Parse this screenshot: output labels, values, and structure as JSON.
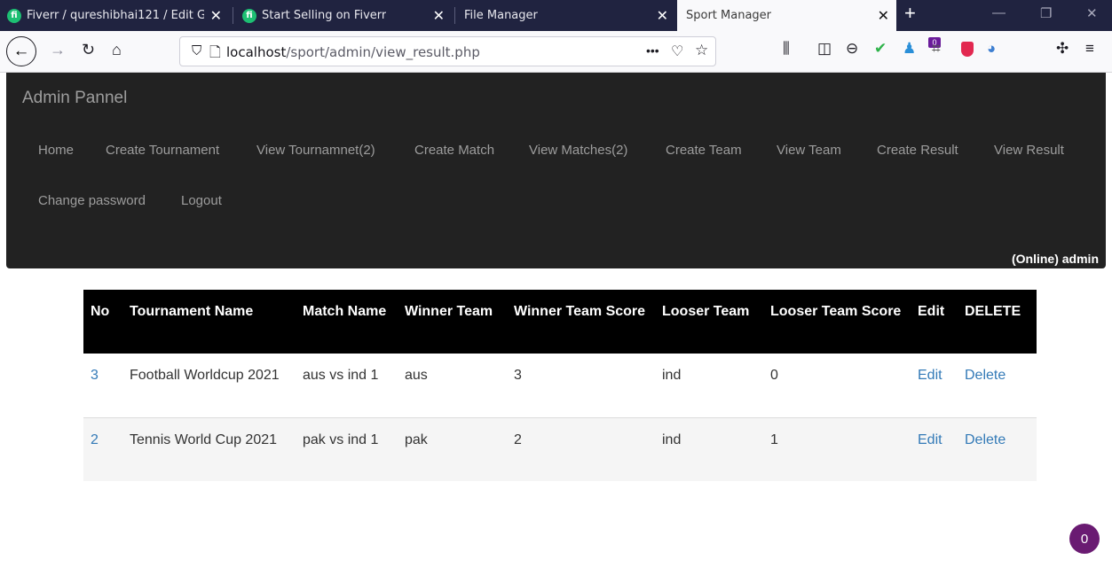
{
  "browser": {
    "tabs": [
      {
        "title": "Fiverr / qureshibhai121 / Edit G",
        "has_favicon": true,
        "active": false
      },
      {
        "title": "Start Selling on Fiverr",
        "has_favicon": true,
        "active": false
      },
      {
        "title": "File Manager",
        "has_favicon": false,
        "active": false
      },
      {
        "title": "Sport Manager",
        "has_favicon": false,
        "active": true
      }
    ],
    "url_host": "localhost",
    "url_path": "/sport/admin/view_result.php",
    "page_actions": "•••",
    "extension_badge": "0"
  },
  "admin": {
    "brand": "Admin Pannel",
    "menu_row1": [
      "Home",
      "Create Tournament",
      "View Tournamnet(2)",
      "Create Match",
      "View Matches(2)",
      "Create Team",
      "View Team",
      "Create Result",
      "View Result"
    ],
    "menu_row2": [
      "Change password",
      "Logout"
    ],
    "status": "(Online) admin"
  },
  "results_table": {
    "headers": [
      "No",
      "Tournament Name",
      "Match Name",
      "Winner Team",
      "Winner Team Score",
      "Looser Team",
      "Looser Team Score",
      "Edit",
      "DELETE"
    ],
    "rows": [
      {
        "no": "3",
        "tournament": "Football Worldcup 2021",
        "match": "aus vs ind 1",
        "winner": "aus",
        "winner_score": "3",
        "looser": "ind",
        "looser_score": "0",
        "edit": "Edit",
        "delete": "Delete"
      },
      {
        "no": "2",
        "tournament": "Tennis World Cup 2021",
        "match": "pak vs ind 1",
        "winner": "pak",
        "winner_score": "2",
        "looser": "ind",
        "looser_score": "1",
        "edit": "Edit",
        "delete": "Delete"
      }
    ]
  },
  "floating_badge": "0",
  "colors": {
    "tabstrip_bg": "#202340",
    "admin_header_bg": "#222222",
    "table_header_bg": "#000000",
    "link": "#337ab7",
    "badge": "#6a1b72"
  }
}
